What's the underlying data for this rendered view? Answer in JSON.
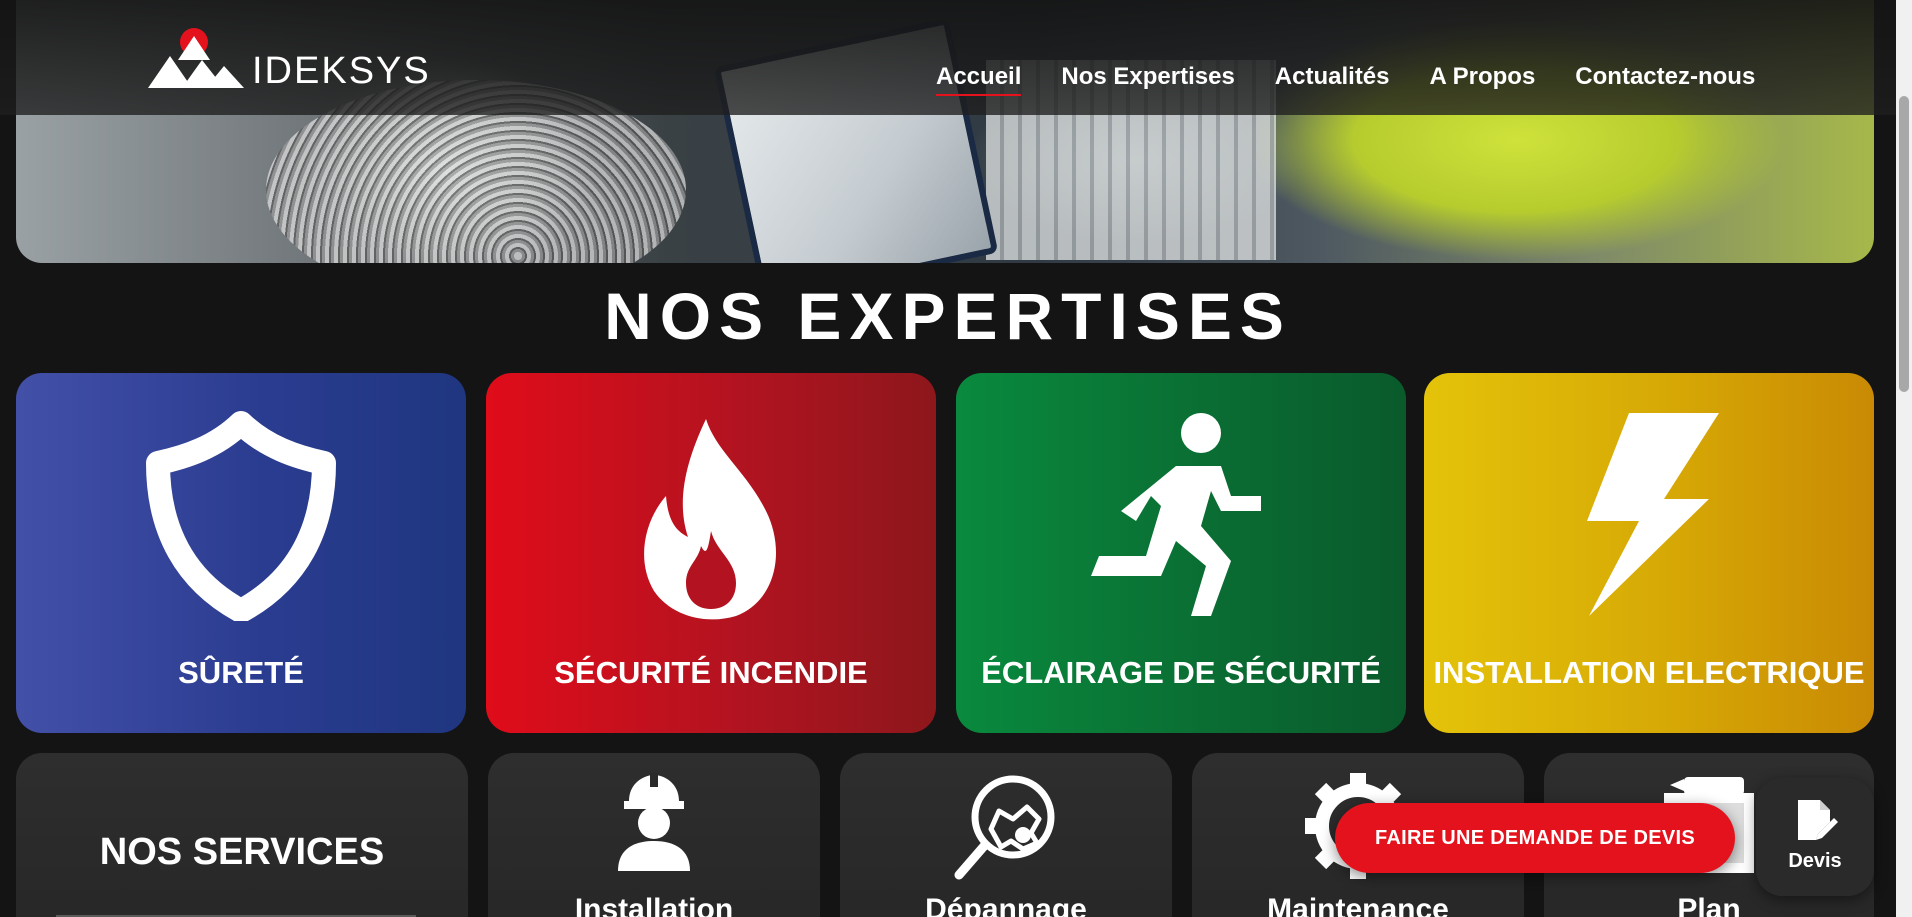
{
  "brand": {
    "name": "IDEKSYS",
    "accent": "#e3121d"
  },
  "nav": {
    "items": [
      {
        "label": "Accueil",
        "active": true
      },
      {
        "label": "Nos Expertises",
        "active": false
      },
      {
        "label": "Actualités",
        "active": false
      },
      {
        "label": "A Propos",
        "active": false
      },
      {
        "label": "Contactez-nous",
        "active": false
      }
    ]
  },
  "expertises": {
    "title": "NOS EXPERTISES",
    "cards": [
      {
        "label": "SÛRETÉ",
        "icon": "shield-icon",
        "color": "#2a3c90"
      },
      {
        "label": "SÉCURITÉ INCENDIE",
        "icon": "flame-icon",
        "color": "#b31320"
      },
      {
        "label": "ÉCLAIRAGE DE SÉCURITÉ",
        "icon": "running-man-icon",
        "color": "#0a6e33"
      },
      {
        "label": "INSTALLATION ELECTRIQUE",
        "icon": "lightning-icon",
        "color": "#d6a805"
      }
    ]
  },
  "services": {
    "title": "NOS SERVICES",
    "items": [
      {
        "label": "Installation",
        "icon": "worker-icon"
      },
      {
        "label": "Dépannage",
        "icon": "magnifier-icon"
      },
      {
        "label": "Maintenance",
        "icon": "gear-icon"
      },
      {
        "label": "Plan",
        "icon": "blueprint-icon"
      }
    ]
  },
  "cta": {
    "label": "FAIRE UNE DEMANDE DE DEVIS"
  },
  "devis": {
    "label": "Devis",
    "icon": "edit-document-icon"
  }
}
